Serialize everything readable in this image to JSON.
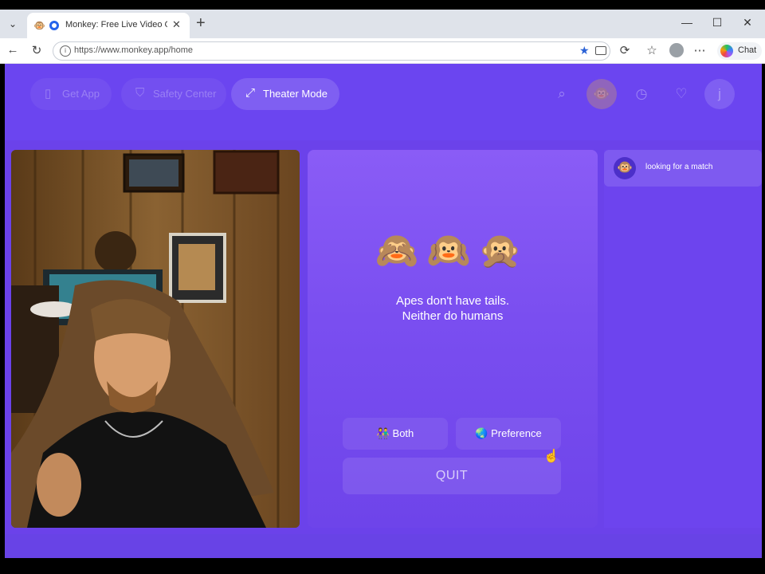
{
  "browser": {
    "tab_title": "Monkey: Free Live Video Chat",
    "url": "https://www.monkey.app/home",
    "copilot_label": "Chat"
  },
  "header": {
    "get_app": "Get App",
    "safety_center": "Safety Center",
    "theater_mode": "Theater Mode",
    "user_initial": "j"
  },
  "panel": {
    "emojis": "🙈🙉🙊",
    "quote_line1": "Apes don't have tails.",
    "quote_line2": "Neither do humans",
    "both_label": "Both",
    "both_icon": "👫",
    "preference_label": "Preference",
    "preference_icon": "🌏",
    "quit_label": "QUIT"
  },
  "chat": {
    "status_icon": "🐵",
    "status_text": "looking for a match"
  },
  "colors": {
    "page_bg": "#6b42ea",
    "panel_top": "#8a5cf6",
    "accent_blue": "#2b62d6"
  }
}
